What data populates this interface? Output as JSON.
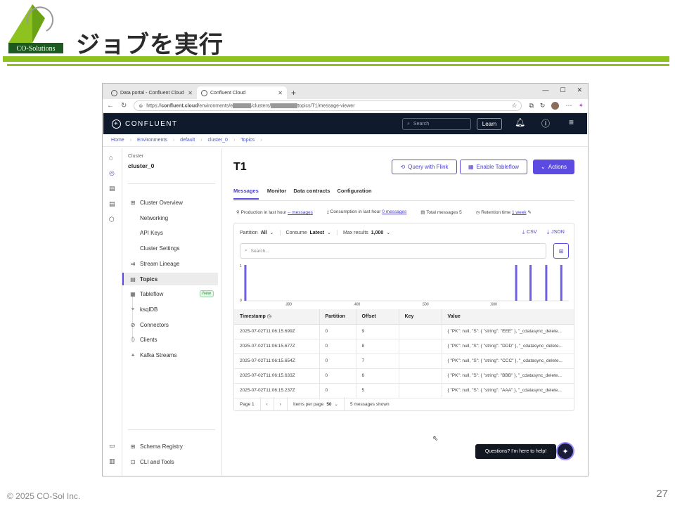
{
  "slide": {
    "logo_text": "CO-Solutions",
    "title": "ジョブを実行",
    "copyright": "© 2025 CO-Sol Inc.",
    "page_number": "27",
    "accent_color": "#8dc21f"
  },
  "browser": {
    "tabs": [
      {
        "label": "Data portal - Confluent Cloud",
        "active": false
      },
      {
        "label": "Confluent Cloud",
        "active": true
      }
    ],
    "new_tab_icon": "plus-icon",
    "url_prefix": "https://",
    "url_host": "confluent.cloud",
    "url_path_1": "/environments/e",
    "url_path_2": "/clusters/",
    "url_path_3": "topics/T1/message-viewer"
  },
  "topbar": {
    "brand": "CONFLUENT",
    "search_placeholder": "Search",
    "learn_label": "Learn"
  },
  "breadcrumbs": [
    "Home",
    "Environments",
    "default",
    "cluster_0",
    "Topics"
  ],
  "sidebar": {
    "cluster_label": "Cluster",
    "cluster_name": "cluster_0",
    "items": [
      {
        "label": "Cluster Overview",
        "icon": "grid-icon"
      },
      {
        "label": "Networking"
      },
      {
        "label": "API Keys"
      },
      {
        "label": "Cluster Settings"
      },
      {
        "label": "Stream Lineage",
        "icon": "lineage-icon"
      },
      {
        "label": "Topics",
        "icon": "topics-icon",
        "active": true
      },
      {
        "label": "Tableflow",
        "icon": "table-icon",
        "badge": "New"
      },
      {
        "label": "ksqlDB",
        "icon": "tag-icon"
      },
      {
        "label": "Connectors",
        "icon": "connector-icon"
      },
      {
        "label": "Clients",
        "icon": "clients-icon"
      },
      {
        "label": "Kafka Streams",
        "icon": "streams-icon"
      }
    ],
    "bottom_items": [
      {
        "label": "Schema Registry",
        "icon": "schema-icon"
      },
      {
        "label": "CLI and Tools",
        "icon": "cli-icon"
      }
    ]
  },
  "main": {
    "title": "T1",
    "query_flink_label": "Query with Flink",
    "enable_tableflow_label": "Enable Tableflow",
    "actions_label": "Actions",
    "tabs": [
      "Messages",
      "Monitor",
      "Data contracts",
      "Configuration"
    ],
    "stats": {
      "production_label": "Production in last hour",
      "production_value": "-- messages",
      "consumption_label": "Consumption in last hour",
      "consumption_value": "0 messages",
      "total_label": "Total messages",
      "total_value": "5",
      "retention_label": "Retention time",
      "retention_value": "1 week"
    },
    "filters": {
      "partition_label": "Partition",
      "partition_value": "All",
      "consume_label": "Consume",
      "consume_value": "Latest",
      "maxres_label": "Max results",
      "maxres_value": "1,000"
    },
    "csv_label": "CSV",
    "json_label": "JSON",
    "search_placeholder": "Search..."
  },
  "chart_data": {
    "type": "bar",
    "title": "",
    "ylim": [
      0,
      1
    ],
    "y_ticks": [
      "1",
      "0"
    ],
    "x_ticks": [
      ".300",
      ".400",
      ".500",
      ".600"
    ],
    "x_range": [
      0.235,
      0.71
    ],
    "x": [
      0.237,
      0.633,
      0.654,
      0.677,
      0.699
    ],
    "values": [
      1,
      1,
      1,
      1,
      1
    ],
    "color": "#6f5fe8"
  },
  "table": {
    "columns": [
      "Timestamp",
      "Partition",
      "Offset",
      "Key",
      "Value"
    ],
    "rows": [
      [
        "2025-07-02T11:06:15.699Z",
        "0",
        "9",
        "",
        "{ \"PK\": null, \"S\": { \"string\": \"EEE\" }, \"_cdatasync_delete..."
      ],
      [
        "2025-07-02T11:06:15.677Z",
        "0",
        "8",
        "",
        "{ \"PK\": null, \"S\": { \"string\": \"DDD\" }, \"_cdatasync_delete..."
      ],
      [
        "2025-07-02T11:06:15.654Z",
        "0",
        "7",
        "",
        "{ \"PK\": null, \"S\": { \"string\": \"CCC\" }, \"_cdatasync_delete..."
      ],
      [
        "2025-07-02T11:06:15.633Z",
        "0",
        "6",
        "",
        "{ \"PK\": null, \"S\": { \"string\": \"BBB\" }, \"_cdatasync_delete..."
      ],
      [
        "2025-07-02T11:06:15.237Z",
        "0",
        "5",
        "",
        "{ \"PK\": null, \"S\": { \"string\": \"AAA\" }, \"_cdatasync_delete..."
      ]
    ]
  },
  "pager": {
    "page_label": "Page 1",
    "items_label": "Items per page",
    "items_value": "50",
    "shown_label": "5 messages shown"
  },
  "help": {
    "bubble_text": "Questions? I'm here to help!"
  }
}
